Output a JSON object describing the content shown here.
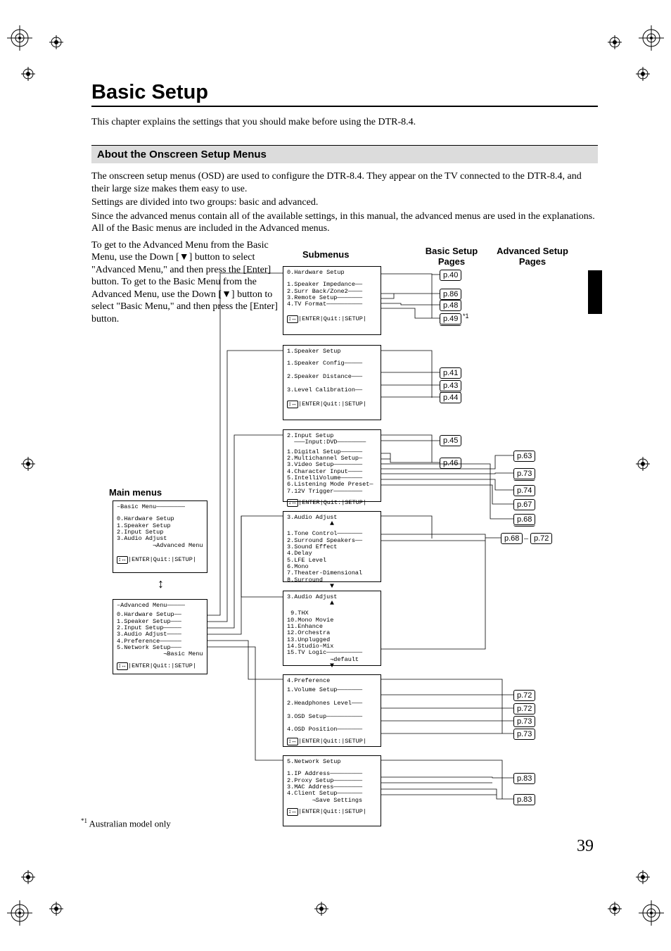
{
  "chapter_title": "Basic Setup",
  "intro": "This chapter explains the settings that you should make before using the DTR-8.4.",
  "section_title": "About the Onscreen Setup Menus",
  "body": {
    "p1": "The onscreen setup menus (OSD) are used to configure the DTR-8.4. They appear on the TV connected to the DTR-8.4, and their large size makes them easy to use.",
    "p2": "Settings are divided into two groups: basic and advanced.",
    "p3": "Since the advanced menus contain all of the available settings, in this manual, the advanced menus are used in the explanations. All of the Basic menus are included in the Advanced menus.",
    "nav": "To get to the Advanced Menu from the Basic Menu, use the Down [▼] button to select \"Advanced Menu,\" and then press the [Enter] button. To get to the Basic Menu from the Advanced Menu, use the Down [▼] button to select \"Basic Menu,\" and then press the [Enter] button."
  },
  "columns": {
    "submenus": "Submenus",
    "basic": "Basic Setup Pages",
    "advanced": "Advanced Setup Pages"
  },
  "main_menus_label": "Main menus",
  "main_menu_basic": {
    "title": "–Basic Menu————————",
    "items": "0.Hardware Setup\n1.Speaker Setup\n2.Input Setup\n3.Audio Adjust\n          ¬Advanced Menu",
    "foot": "↕↔|ENTER|Quit:|SETUP|"
  },
  "main_menu_advanced": {
    "title": "–Advanced Menu—————",
    "items": "0.Hardware Setup——\n1.Speaker Setup———\n2.Input Setup—————\n3.Audio Adjust————\n4.Preference——————\n5.Network Setup———\n             ¬Basic Menu",
    "foot": "↕↔|ENTER|Quit:|SETUP|"
  },
  "sub0": {
    "title": "0.Hardware Setup",
    "items": "1.Speaker Impedance——\n2.Surr Back/Zone2————\n3.Remote Setup———————\n4.TV Format——————————",
    "foot": "↕↔|ENTER|Quit:|SETUP|"
  },
  "sub1": {
    "title": "1.Speaker Setup",
    "items": "1.Speaker Config—————\n\n2.Speaker Distance———\n\n3.Level Calibration——",
    "foot": "↕↔|ENTER|Quit:|SETUP|"
  },
  "sub2": {
    "title": "2.Input Setup\n  ———Input:DVD————————",
    "items": "1.Digital Setup——————\n2.Multichannel Setup—\n3.Video Setup————————\n4.Character Input————\n5.IntelliVolume——————\n6.Listening Mode Preset—\n7.12V Trigger————————",
    "foot": "↕↔|ENTER|Quit:|SETUP|"
  },
  "sub3a": {
    "title": "3.Audio Adjust",
    "up": "▲",
    "items": "1.Tone Control———————\n2.Surround Speakers——\n3.Sound Effect\n4.Delay\n5.LFE Level\n6.Mono\n7.Theater-Dimensional\n8.Surround",
    "down": "▼"
  },
  "sub3b": {
    "title": "3.Audio Adjust",
    "up": "▲",
    "items": " 9.THX\n10.Mono Movie\n11.Enhance\n12.Orchestra\n13.Unplugged\n14.Studio-Mix\n15.TV Logic——————————\n            ¬default",
    "down": "▼"
  },
  "sub4": {
    "title": "4.Preference",
    "items": "1.Volume Setup———————\n\n2.Headphones Level———\n\n3.OSD Setup——————————\n\n4.OSD Position———————",
    "foot": "↕↔|ENTER|Quit:|SETUP|"
  },
  "sub5": {
    "title": "5.Network Setup",
    "items": "1.IP Address—————————\n2.Proxy Setup————————\n3.MAC Address————————\n4.Client Setup———————\n       ¬Save Settings",
    "foot": "↕↔|ENTER|Quit:|SETUP|"
  },
  "prefs": {
    "p40": "p.40",
    "p86": "p.86",
    "p48": "p.48",
    "p49": "p.49",
    "p41": "p.41",
    "p43": "p.43",
    "p44": "p.44",
    "p45": "p.45",
    "p46": "p.46",
    "p63": "p.63",
    "p73a": "p.73",
    "p74": "p.74",
    "p67": "p.67",
    "p68a": "p.68",
    "p68b": "p.68",
    "p72a": "p.72",
    "p72b": "p.72",
    "p72c": "p.72",
    "p73b": "p.73",
    "p73c": "p.73",
    "p83a": "p.83",
    "p83b": "p.83"
  },
  "range_dash": "–",
  "star1": "*1",
  "footnote_marker": "*1",
  "footnote_text": "Australian model only",
  "page_number": "39",
  "vdbl": "↕"
}
